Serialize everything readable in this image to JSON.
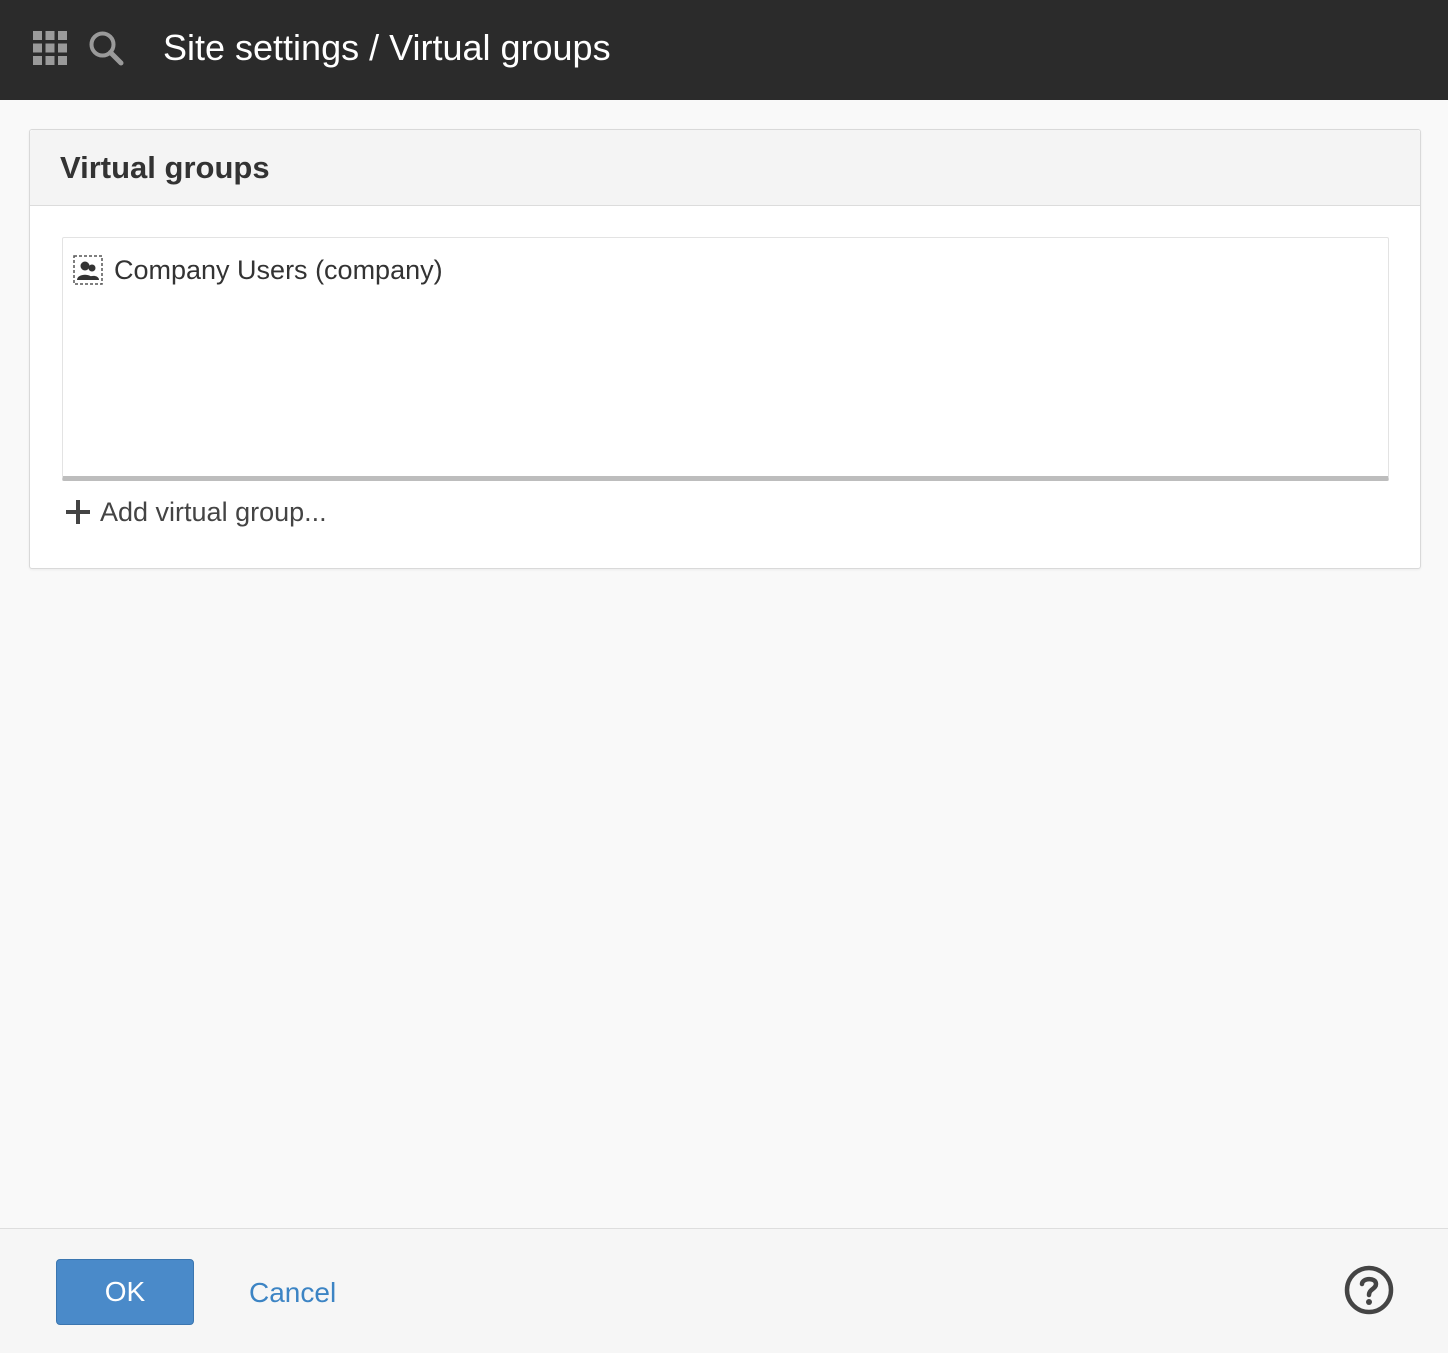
{
  "header": {
    "title": "Site settings / Virtual groups",
    "apps_icon": "apps-grid-icon",
    "search_icon": "search-icon"
  },
  "panel": {
    "title": "Virtual groups",
    "groups": [
      {
        "label": "Company Users (company)",
        "icon": "virtual-group-icon"
      }
    ],
    "add_label": "Add virtual group...",
    "add_icon": "plus-icon"
  },
  "footer": {
    "ok_label": "OK",
    "cancel_label": "Cancel",
    "help_icon": "help-icon"
  },
  "colors": {
    "topbar": "#2b2b2b",
    "primary": "#4a8ac9",
    "link": "#3c84c4"
  }
}
